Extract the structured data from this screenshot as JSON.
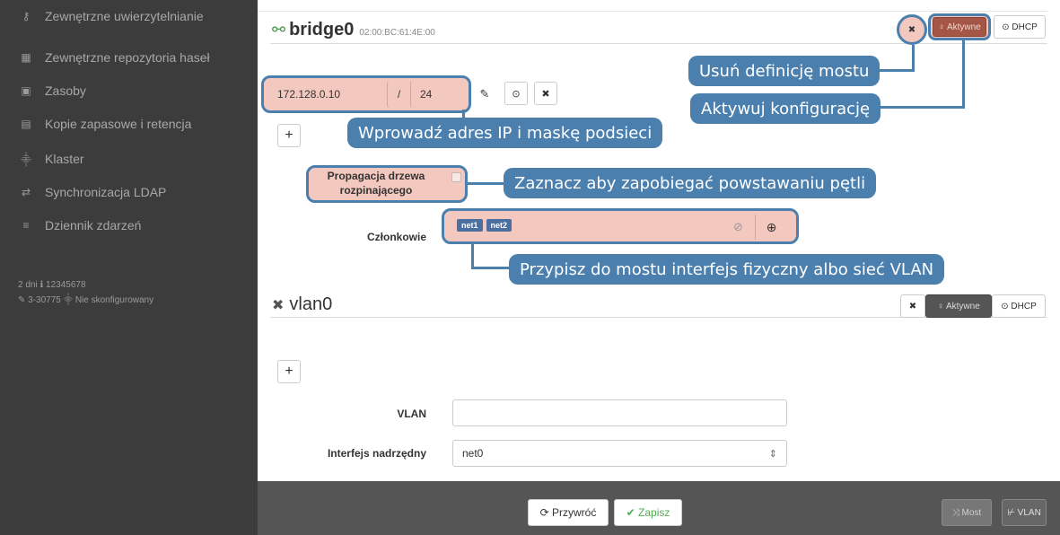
{
  "sidebar": {
    "items": [
      {
        "icon": "key-icon",
        "glyph": "⚷",
        "label": "Zewnętrzne uwierzytelnianie"
      },
      {
        "icon": "grid-icon",
        "glyph": "▦",
        "label": "Zewnętrzne repozytoria haseł"
      },
      {
        "icon": "image-icon",
        "glyph": "▣",
        "label": "Zasoby"
      },
      {
        "icon": "archive-icon",
        "glyph": "▤",
        "label": "Kopie zapasowe i retencja"
      },
      {
        "icon": "sitemap-icon",
        "glyph": "⸎",
        "label": "Klaster"
      },
      {
        "icon": "exchange-icon",
        "glyph": "⇄",
        "label": "Synchronizacja LDAP"
      },
      {
        "icon": "list-icon",
        "glyph": "≡",
        "label": "Dziennik zdarzeń"
      }
    ],
    "meta_line1": "2 dni  ℹ 12345678",
    "meta_line2": "✎ 3-30775   ⸎ Nie skonfigurowany"
  },
  "bridge": {
    "icon_glyph": "⚯",
    "name": "bridge0",
    "mac": "02:00:BC:61:4E:00",
    "remove_glyph": "✖",
    "active_label": "♀ Aktywne",
    "dhcp_label": "⊙ DHCP",
    "ip": "172.128.0.10",
    "slash": "/",
    "mask": "24",
    "wrench_glyph": "✎",
    "globe_glyph": "⊙",
    "x_glyph": "✖",
    "add_glyph": "+",
    "stp_label": "Propagacja drzewa rozpinającego",
    "members_label": "Członkowie",
    "members": [
      "net1",
      "net2"
    ],
    "clear_glyph": "⊘",
    "zoom_glyph": "⊕"
  },
  "callouts": {
    "remove": "Usuń definicję mostu",
    "activate": "Aktywuj konfigurację",
    "ip": "Wprowadź adres IP i maskę podsieci",
    "stp": "Zaznacz aby zapobiegać powstawaniu pętli",
    "members": "Przypisz do mostu interfejs fizyczny albo sieć VLAN"
  },
  "vlan": {
    "icon_glyph": "✖",
    "name": "vlan0",
    "remove_glyph": "✖",
    "active_label": "♀ Aktywne",
    "dhcp_label": "⊙ DHCP",
    "add_glyph": "+",
    "vlan_label": "VLAN",
    "vlan_value": "",
    "parent_label": "Interfejs nadrzędny",
    "parent_value": "net0",
    "parent_arrow": "⇕"
  },
  "footer": {
    "revert": "⟳ Przywróć",
    "save": "✔ Zapisz",
    "bridge": "⤨ Most",
    "vlan": "⊬ VLAN"
  },
  "colors": {
    "accent": "#4b7fae",
    "highlight": "#f3c8bf",
    "sidebar": "#3c3c3c",
    "save_green": "#5cb85c"
  }
}
